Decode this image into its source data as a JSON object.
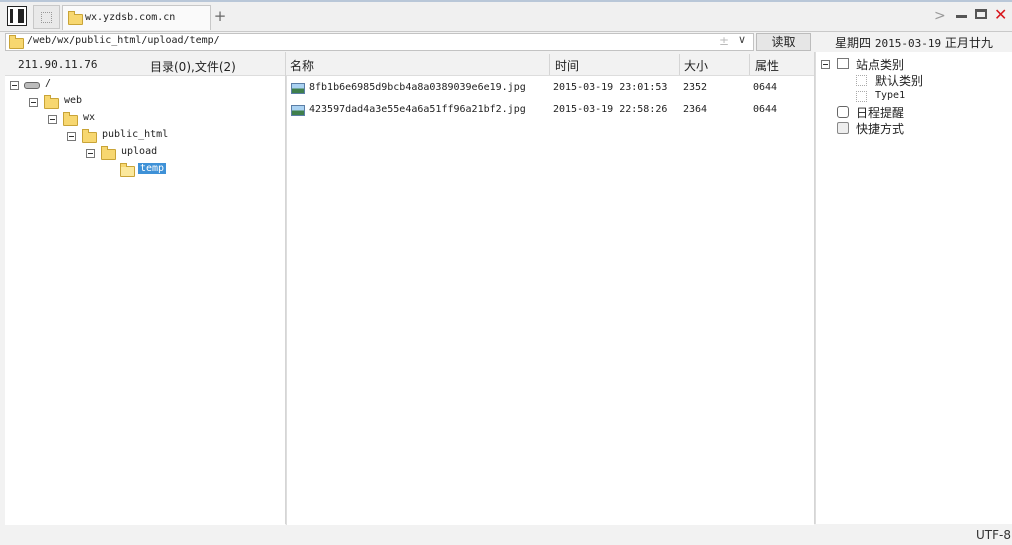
{
  "tabs": [
    {
      "label": "wx.yzdsb.com.cn"
    }
  ],
  "toolbar": {
    "path": "/web/wx/public_html/upload/temp/",
    "read_label": "读取",
    "star": "±",
    "dropdown": "∨"
  },
  "date_info": {
    "weekday": "星期四",
    "date": "2015-03-19",
    "lunar": "正月廿九"
  },
  "left_header": {
    "server": "211.90.11.76",
    "counts": "目录(0),文件(2)"
  },
  "tree": [
    {
      "label": "/",
      "icon": "drive-icon"
    },
    {
      "label": "web",
      "icon": "folder-icon"
    },
    {
      "label": "wx",
      "icon": "folder-icon"
    },
    {
      "label": "public_html",
      "icon": "folder-icon"
    },
    {
      "label": "upload",
      "icon": "folder-icon"
    },
    {
      "label": "temp",
      "icon": "folder-open-icon",
      "selected": true
    }
  ],
  "columns": {
    "name": "名称",
    "time": "时间",
    "size": "大小",
    "attr": "属性"
  },
  "files": [
    {
      "name": "8fb1b6e6985d9bcb4a8a0389039e6e19.jpg",
      "time": "2015-03-19 23:01:53",
      "size": "2352",
      "attr": "0644"
    },
    {
      "name": "423597dad4a3e55e4a6a51ff96a21bf2.jpg",
      "time": "2015-03-19 22:58:26",
      "size": "2364",
      "attr": "0644"
    }
  ],
  "sidebar": {
    "site_category": "站点类别",
    "default_category": "默认类别",
    "type1": "Type1",
    "schedule": "日程提醒",
    "shortcuts": "快捷方式"
  },
  "status": {
    "encoding": "UTF-8"
  },
  "colors": {
    "selection": "#3e91d7",
    "close": "#d8161c",
    "folder": "#f7d770"
  }
}
